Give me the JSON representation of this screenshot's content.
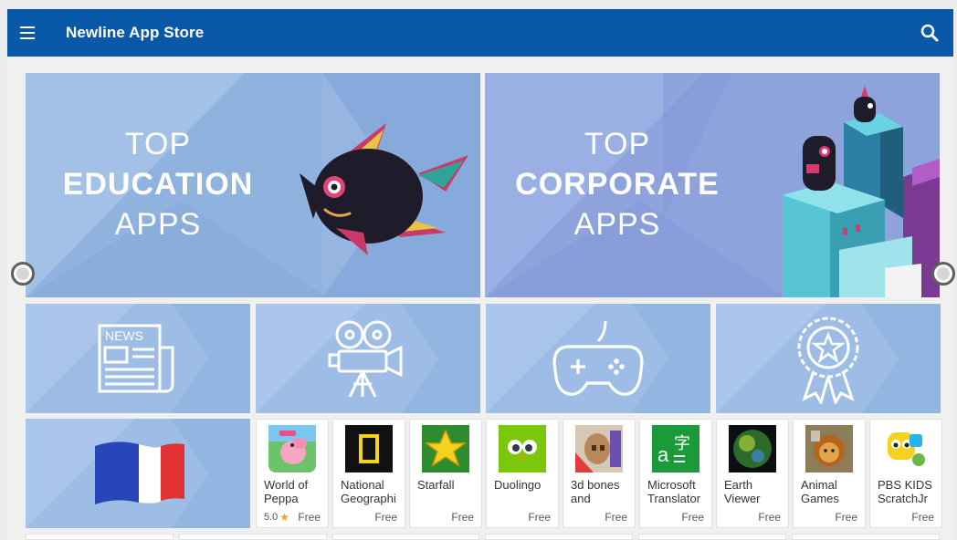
{
  "header": {
    "title": "Newline App Store",
    "menu_icon": "hamburger-menu-icon",
    "search_icon": "search-icon",
    "bar_color": "#0a59a8"
  },
  "banners": [
    {
      "line1": "TOP",
      "line2": "EDUCATION",
      "line3": "APPS",
      "art_icon": "flying-fish-icon"
    },
    {
      "line1": "TOP",
      "line2": "CORPORATE",
      "line3": "APPS",
      "art_icon": "robot-tower-icon"
    }
  ],
  "categories": [
    {
      "icon": "newspaper-icon",
      "label": "NEWS"
    },
    {
      "icon": "movie-camera-icon"
    },
    {
      "icon": "gamepad-icon"
    },
    {
      "icon": "award-ribbon-icon"
    }
  ],
  "featured_tile": {
    "icon": "france-flag-icon"
  },
  "apps": [
    {
      "name": "World of Peppa",
      "rating": "5.0",
      "price": "Free"
    },
    {
      "name": "National Geographi",
      "price": "Free"
    },
    {
      "name": "Starfall",
      "price": "Free"
    },
    {
      "name": "Duolingo",
      "price": "Free"
    },
    {
      "name": "3d bones and",
      "price": "Free"
    },
    {
      "name": "Microsoft Translator",
      "price": "Free"
    },
    {
      "name": "Earth Viewer",
      "price": "Free"
    },
    {
      "name": "Animal Games",
      "price": "Free"
    },
    {
      "name": "PBS KIDS ScratchJr",
      "price": "Free"
    }
  ]
}
